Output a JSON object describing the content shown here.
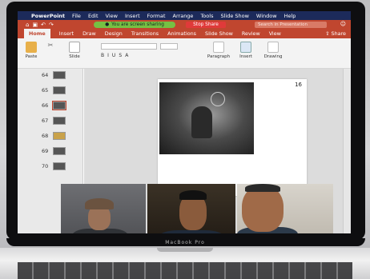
{
  "menubar": {
    "apple": "",
    "app": "PowerPoint",
    "items": [
      "File",
      "Edit",
      "View",
      "Insert",
      "Format",
      "Arrange",
      "Tools",
      "Slide Show",
      "Window",
      "Help"
    ]
  },
  "titlebar": {
    "share_status": "You are screen sharing",
    "stop_share": "Stop Share",
    "search_placeholder": "Search in Presentation"
  },
  "ribbon_tabs": {
    "items": [
      "Home",
      "Insert",
      "Draw",
      "Design",
      "Transitions",
      "Animations",
      "Slide Show",
      "Review",
      "View"
    ],
    "active": "Home",
    "share": "Share"
  },
  "ribbon": {
    "paste": "Paste",
    "slide": "Slide",
    "paragraph": "Paragraph",
    "insert": "Insert",
    "drawing": "Drawing"
  },
  "thumbnails": [
    "64",
    "65",
    "66",
    "67",
    "68",
    "69",
    "70"
  ],
  "selected_thumbnail": "66",
  "slide": {
    "number": "16",
    "title": "",
    "lines": [
      "",
      "",
      "",
      "",
      "",
      ""
    ],
    "caption": ""
  },
  "laptop": {
    "brand": "MacBook Pro"
  },
  "colors": {
    "ribbon_red": "#c0462f",
    "menubar_navy": "#1c2a5a",
    "share_green": "#76c043"
  }
}
